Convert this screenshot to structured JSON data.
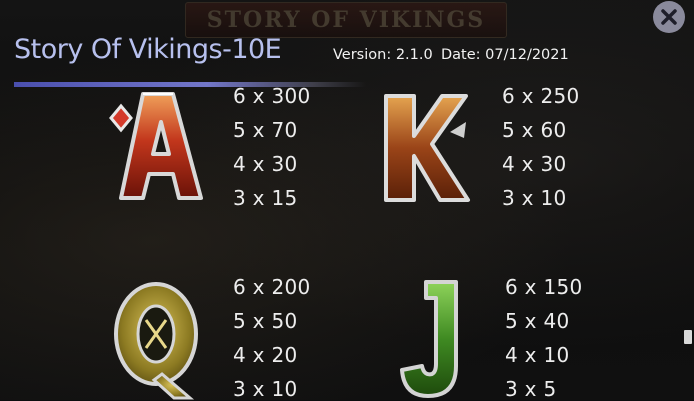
{
  "header": {
    "title": "Story Of Vikings-10E",
    "version": "Version: 2.1.0",
    "date": "Date: 07/12/2021",
    "background_banner": "STORY OF VIKINGS"
  },
  "colors": {
    "title": "#b7c0ee",
    "underline": "#6a6fc2",
    "close_button": "#8a8a9c",
    "text": "#ededed"
  },
  "paytable": {
    "A": {
      "icon": "letter-a-symbol-icon",
      "pays": [
        "6 x 300",
        "5 x 70",
        "4 x 30",
        "3 x 15"
      ]
    },
    "K": {
      "icon": "letter-k-symbol-icon",
      "pays": [
        "6 x 250",
        "5 x 60",
        "4 x 30",
        "3 x 10"
      ]
    },
    "Q": {
      "icon": "letter-q-symbol-icon",
      "pays": [
        "6 x 200",
        "5 x 50",
        "4 x 20",
        "3 x 10"
      ]
    },
    "J": {
      "icon": "letter-j-symbol-icon",
      "pays": [
        "6 x 150",
        "5 x 40",
        "4 x 10",
        "3 x 5"
      ]
    }
  },
  "close": {
    "icon": "close-icon"
  }
}
